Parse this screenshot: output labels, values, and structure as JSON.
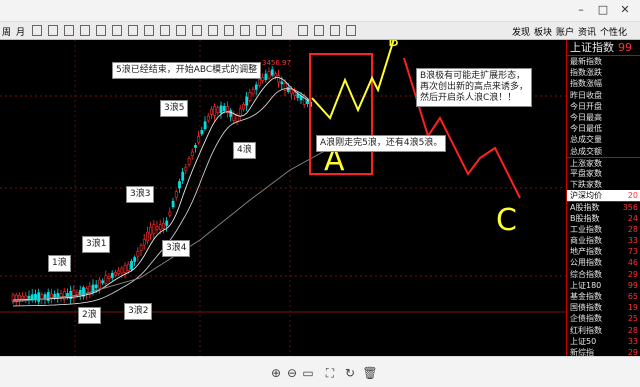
{
  "toolbar": {
    "left_labels": [
      "周",
      "月"
    ],
    "right_labels": [
      "发现",
      "板块",
      "账户",
      "资讯",
      "个性化"
    ]
  },
  "chart": {
    "peak_label": "3456.97",
    "notes": {
      "abc_start": "5浪已经结束，开始ABC模式的调整",
      "wave1": "1浪",
      "wave2": "2浪",
      "wave3_1": "3浪1",
      "wave3_2": "3浪2",
      "wave3_3": "3浪3",
      "wave3_4": "3浪4",
      "wave3_5": "3浪5",
      "wave4": "4浪",
      "a_wave": "A浪刚走完5浪，还有4浪5浪。",
      "b_wave": "B浪极有可能走扩展形态，\n再次创出新的高点来诱多，\n然后开启杀人浪C浪！！"
    },
    "letters": {
      "a": "A",
      "b": "B",
      "c": "C"
    },
    "colors": {
      "up": "#ff3030",
      "down": "#00e0e0",
      "ma": "#e8e8e8",
      "ma_long": "#888888",
      "hand": "#ffff33",
      "red": "#ff2020"
    }
  },
  "panel": {
    "title": "上证指数",
    "title_value": "99",
    "rows": [
      {
        "label": "最新指数",
        "value": ""
      },
      {
        "label": "指数涨跌",
        "value": ""
      },
      {
        "label": "指数涨幅",
        "value": ""
      },
      {
        "label": "昨日收盘",
        "value": ""
      },
      {
        "label": "今日开盘",
        "value": ""
      },
      {
        "label": "今日最高",
        "value": ""
      },
      {
        "label": "今日最低",
        "value": ""
      },
      {
        "label": "总成交量",
        "value": ""
      },
      {
        "label": "总成交额",
        "value": ""
      },
      {
        "label": "上涨家数",
        "value": ""
      },
      {
        "label": "平盘家数",
        "value": ""
      },
      {
        "label": "下跌家数",
        "value": ""
      },
      {
        "label": "沪深均价",
        "value": "20"
      },
      {
        "label": "A股指数",
        "value": "356"
      },
      {
        "label": "B股指数",
        "value": "24"
      },
      {
        "label": "工业指数",
        "value": "28"
      },
      {
        "label": "商业指数",
        "value": "33"
      },
      {
        "label": "地产指数",
        "value": "73"
      },
      {
        "label": "公用指数",
        "value": "46"
      },
      {
        "label": "综合指数",
        "value": "29"
      },
      {
        "label": "上证180",
        "value": "99"
      },
      {
        "label": "基金指数",
        "value": "65"
      },
      {
        "label": "国债指数",
        "value": "19"
      },
      {
        "label": "企债指数",
        "value": "25"
      },
      {
        "label": "红利指数",
        "value": "28"
      },
      {
        "label": "上证50",
        "value": "33"
      },
      {
        "label": "新综指",
        "value": "29"
      }
    ]
  },
  "viewer": {
    "icons": [
      "zoom-in",
      "zoom-out",
      "actual-size",
      "fit-window",
      "rotate",
      "delete"
    ]
  }
}
